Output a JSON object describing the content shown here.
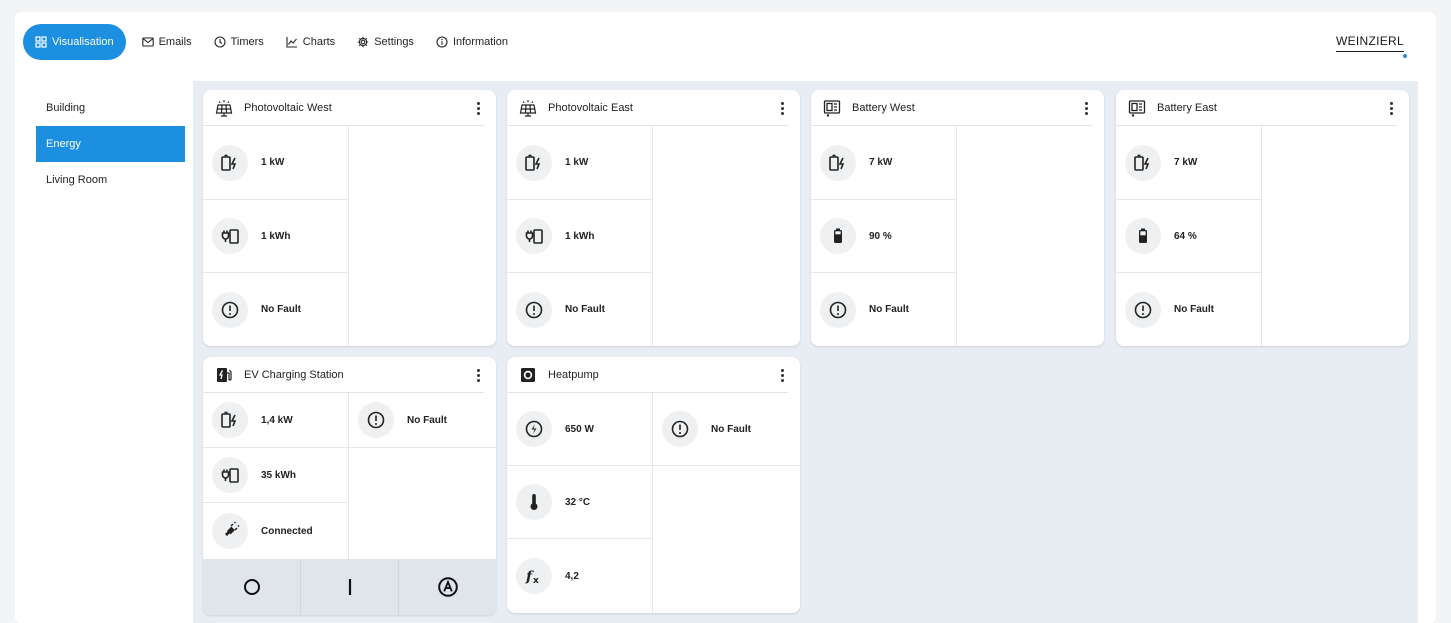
{
  "nav": {
    "tabs": [
      {
        "label": "Visualisation",
        "icon": "grid-icon",
        "active": true
      },
      {
        "label": "Emails",
        "icon": "mail-icon"
      },
      {
        "label": "Timers",
        "icon": "clock-icon"
      },
      {
        "label": "Charts",
        "icon": "chart-line-icon"
      },
      {
        "label": "Settings",
        "icon": "gear-icon"
      },
      {
        "label": "Information",
        "icon": "info-icon"
      }
    ],
    "brand": "WEINZIERL",
    "accent": "#1d8fe1"
  },
  "sidebar": {
    "items": [
      {
        "label": "Building"
      },
      {
        "label": "Energy",
        "active": true
      },
      {
        "label": "Living Room"
      }
    ]
  },
  "cards": {
    "pv_west": {
      "title": "Photovoltaic West",
      "power": "1 kW",
      "energy": "1 kWh",
      "fault": "No Fault"
    },
    "pv_east": {
      "title": "Photovoltaic East",
      "power": "1 kW",
      "energy": "1 kWh",
      "fault": "No Fault"
    },
    "bat_west": {
      "title": "Battery West",
      "power": "7 kW",
      "soc": "90 %",
      "fault": "No Fault"
    },
    "bat_east": {
      "title": "Battery East",
      "power": "7 kW",
      "soc": "64 %",
      "fault": "No Fault"
    },
    "ev": {
      "title": "EV Charging Station",
      "power": "1,4 kW",
      "fault": "No Fault",
      "energy": "35 kWh",
      "status": "Connected",
      "buttons": {
        "off": "O",
        "on": "I",
        "auto": "A"
      }
    },
    "heatpump": {
      "title": "Heatpump",
      "power": "650 W",
      "fault": "No Fault",
      "temperature": "32 °C",
      "cop": "4,2"
    }
  }
}
